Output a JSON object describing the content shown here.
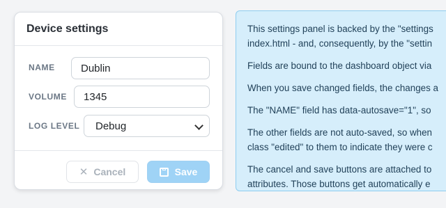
{
  "panel": {
    "title": "Device settings",
    "fields": {
      "name": {
        "label": "NAME",
        "value": "Dublin"
      },
      "volume": {
        "label": "VOLUME",
        "value": "1345"
      },
      "log_level": {
        "label": "LOG LEVEL",
        "value": "Debug"
      }
    },
    "cancel_label": "Cancel",
    "save_label": "Save"
  },
  "info": {
    "lines": [
      "This settings panel is backed by the \"settings",
      "index.html - and, consequently, by the \"settin",
      "Fields are bound to the dashboard object via",
      "When you save changed fields, the changes a",
      "The \"NAME\" field has data-autosave=\"1\", so",
      "The other fields are not auto-saved, so when",
      "class \"edited\" to them to indicate they were c",
      "The cancel and save buttons are attached to",
      "attributes. Those buttons get automatically e"
    ]
  },
  "colors": {
    "save_button_bg": "#9fd3f6",
    "info_bg": "#d6eefb",
    "info_border": "#8ecdf0"
  }
}
